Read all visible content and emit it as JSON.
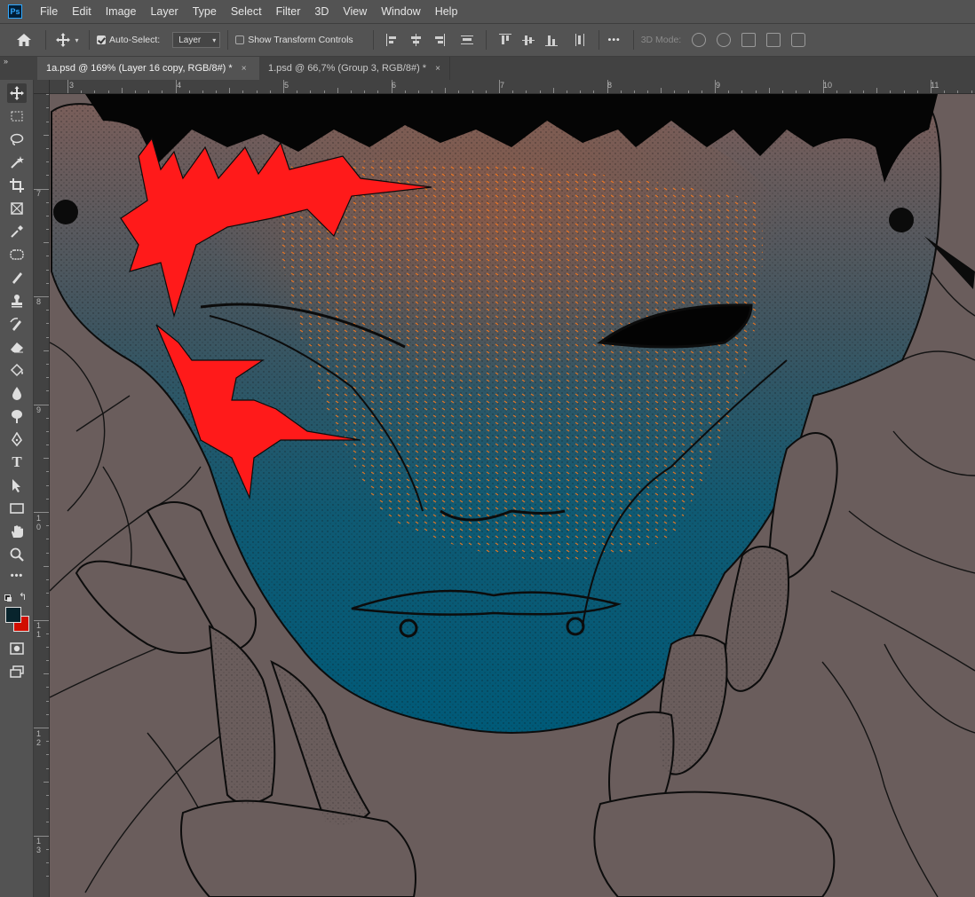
{
  "menu": {
    "logo": "Ps",
    "items": [
      "File",
      "Edit",
      "Image",
      "Layer",
      "Type",
      "Select",
      "Filter",
      "3D",
      "View",
      "Window",
      "Help"
    ]
  },
  "options": {
    "auto_select_label": "Auto-Select:",
    "auto_select_checked": true,
    "layer_select_value": "Layer",
    "show_transform_label": "Show Transform Controls",
    "show_transform_checked": false,
    "more_label": "•••",
    "mode3d_label": "3D Mode:"
  },
  "tabs": [
    {
      "label": "1a.psd @ 169% (Layer 16 copy, RGB/8#) *",
      "close": "×",
      "active": true
    },
    {
      "label": "1.psd @ 66,7% (Group 3, RGB/8#) *",
      "close": "×",
      "active": false
    }
  ],
  "panel_collapse_label": "»",
  "toolbar": {
    "tools": [
      "move-tool-icon",
      "marquee-tool-icon",
      "lasso-tool-icon",
      "magic-wand-tool-icon",
      "crop-tool-icon",
      "frame-tool-icon",
      "eyedropper-tool-icon",
      "spot-healing-tool-icon",
      "brush-tool-icon",
      "clone-stamp-tool-icon",
      "history-brush-tool-icon",
      "eraser-tool-icon",
      "paint-bucket-tool-icon",
      "blur-tool-icon",
      "dodge-tool-icon",
      "pen-tool-icon",
      "type-tool-icon",
      "path-selection-tool-icon",
      "rectangle-tool-icon",
      "hand-tool-icon",
      "zoom-tool-icon",
      "edit-toolbar-icon"
    ],
    "type_tool_glyph": "T",
    "more_glyph": "•••",
    "foreground_color": "#08242d",
    "background_color": "#d10d00"
  },
  "rulers": {
    "top_labels": [
      "3",
      "4",
      "5",
      "6",
      "7",
      "8",
      "9",
      "10",
      "11"
    ],
    "left_labels": [
      "7",
      "8",
      "9",
      "1 0",
      "1 1",
      "1 2",
      "1 3"
    ]
  },
  "canvas": {
    "background": "#6a5d5c",
    "skin_top": "#7a5e5a",
    "skin_bottom": "#005a78",
    "accent_red": "#ff1a1a",
    "accent_orange": "#ff7a1a"
  }
}
